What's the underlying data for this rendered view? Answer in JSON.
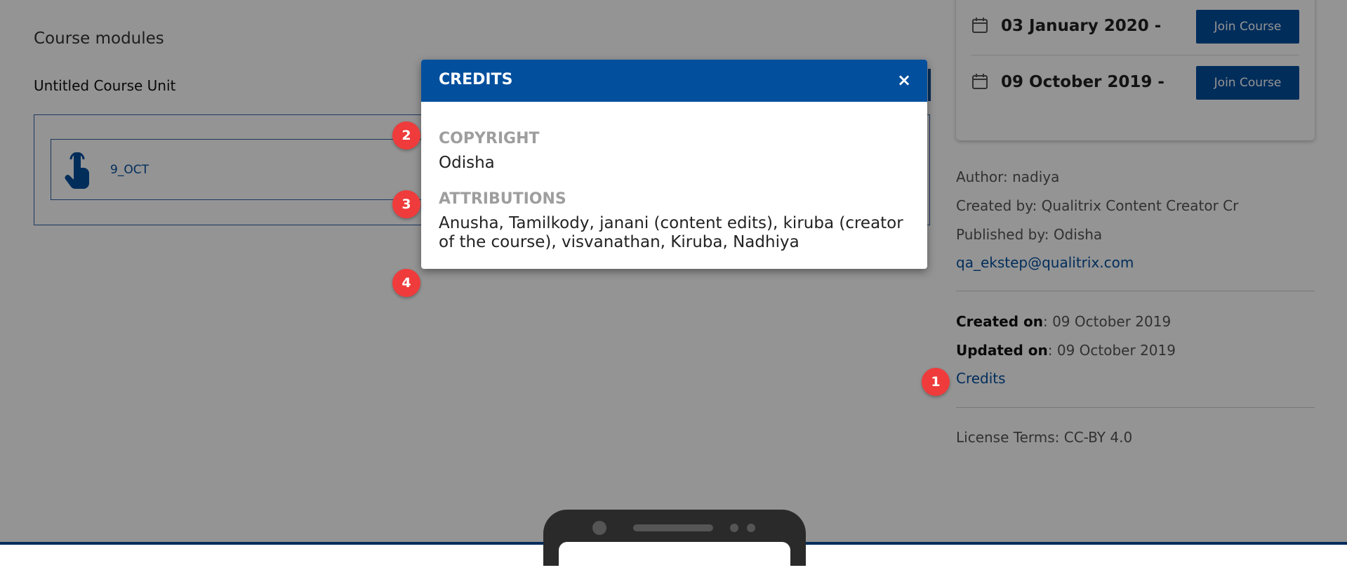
{
  "course": {
    "modules_title": "Course modules",
    "unit_title": "Untitled Course Unit",
    "item_label": "9_OCT"
  },
  "batches": [
    {
      "date": "03 January 2020 -",
      "join_label": "Join Course"
    },
    {
      "date": "09 October 2019 -",
      "join_label": "Join Course"
    }
  ],
  "meta": {
    "author": "Author: nadiya",
    "created_by": "Created by: Qualitrix Content Creator Cr",
    "published_by": "Published by: Odisha",
    "email": "qa_ekstep@qualitrix.com",
    "created_on_label": "Created on",
    "created_on_value": ": 09 October 2019",
    "updated_on_label": "Updated on",
    "updated_on_value": ": 09 October 2019",
    "credits_link": "Credits",
    "license": "License Terms: CC-BY 4.0"
  },
  "modal": {
    "title": "CREDITS",
    "close_icon": "×",
    "copyright_label": "COPYRIGHT",
    "copyright_value": "Odisha",
    "attributions_label": "ATTRIBUTIONS",
    "attributions_value": "Anusha, Tamilkody, janani (content edits), kiruba (creator of the course), visvanathan, Kiruba, Nadhiya"
  },
  "markers": [
    "1",
    "2",
    "3",
    "4"
  ],
  "colors": {
    "primary": "#024f9d",
    "marker": "#ef3b3b",
    "overlay": "rgba(0,0,0,0.42)"
  },
  "icons": {
    "item": "touch-hand-icon",
    "batch": "calendar-icon",
    "close": "close-icon"
  }
}
